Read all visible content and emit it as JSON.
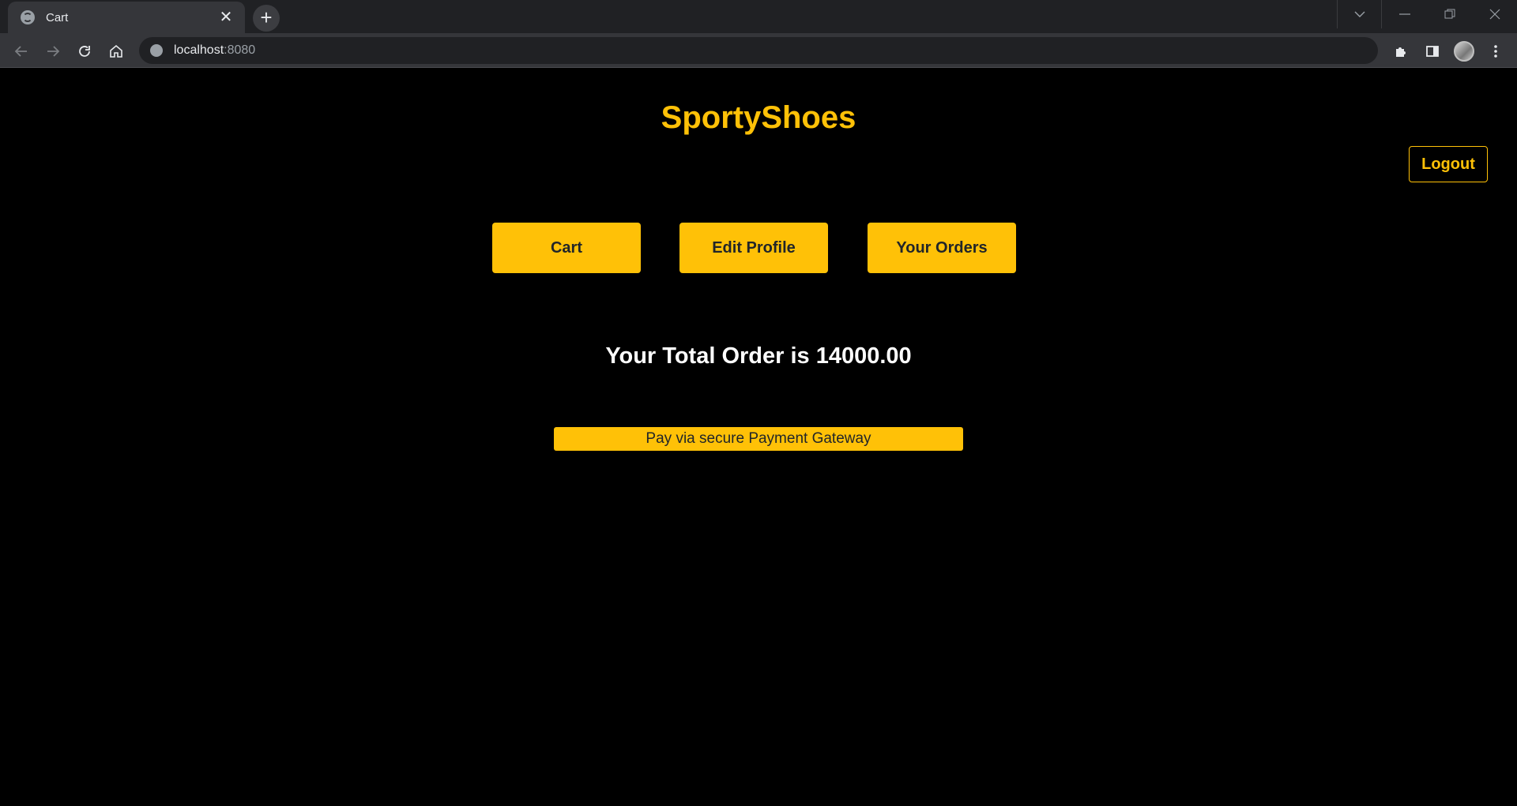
{
  "browser": {
    "tab_title": "Cart",
    "url_host": "localhost",
    "url_port": ":8080"
  },
  "site": {
    "brand": "SportyShoes",
    "logout_label": "Logout"
  },
  "nav": {
    "items": [
      {
        "label": "Cart"
      },
      {
        "label": "Edit Profile"
      },
      {
        "label": "Your Orders"
      }
    ]
  },
  "order": {
    "total_text": "Your Total Order is 14000.00",
    "pay_label": "Pay via secure Payment Gateway"
  },
  "colors": {
    "accent": "#ffc107",
    "background": "#000000"
  }
}
